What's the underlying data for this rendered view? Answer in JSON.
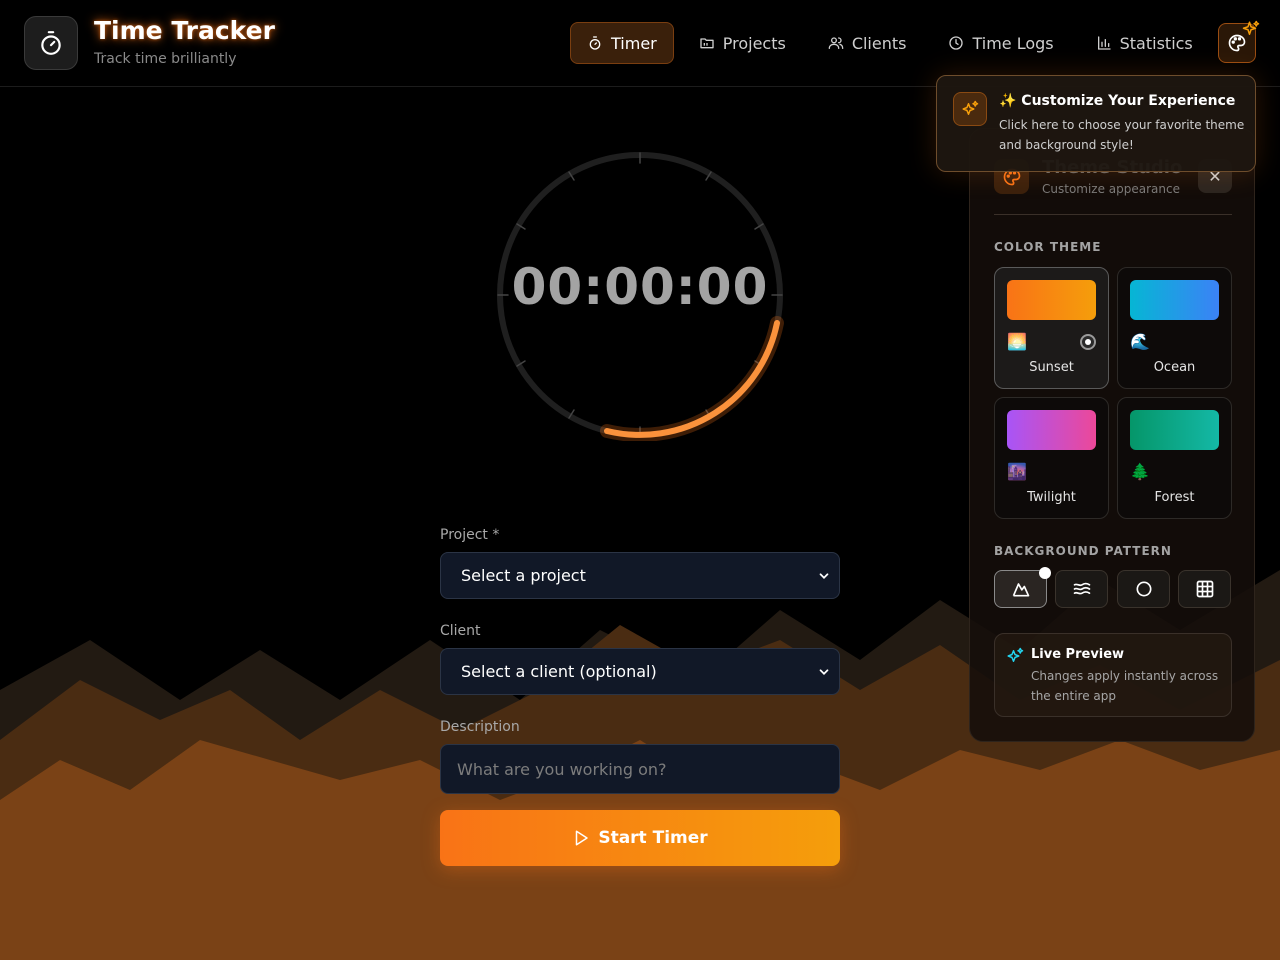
{
  "header": {
    "title": "Time Tracker",
    "subtitle": "Track time brilliantly",
    "logo_icon": "stopwatch-icon"
  },
  "nav": [
    {
      "label": "Timer",
      "icon": "timer-icon",
      "active": true
    },
    {
      "label": "Projects",
      "icon": "folder-icon",
      "active": false
    },
    {
      "label": "Clients",
      "icon": "users-icon",
      "active": false
    },
    {
      "label": "Time Logs",
      "icon": "clock-icon",
      "active": false
    },
    {
      "label": "Statistics",
      "icon": "bar-chart-icon",
      "active": false
    }
  ],
  "timer": {
    "display": "00:00:00",
    "accent_color": "#f97316"
  },
  "form": {
    "project_label": "Project *",
    "project_value": "Select a project",
    "client_label": "Client",
    "client_value": "Select a client (optional)",
    "description_label": "Description",
    "description_placeholder": "What are you working on?",
    "start_button": "Start Timer"
  },
  "tooltip": {
    "title": "✨ Customize Your Experience",
    "text": "Click here to choose your favorite theme and background style!"
  },
  "studio": {
    "title": "Theme Studio",
    "subtitle": "Customize appearance",
    "color_theme_title": "COLOR THEME",
    "themes": [
      {
        "name": "Sunset",
        "emoji": "🌅",
        "selected": true,
        "gradient_from": "#f97316",
        "gradient_to": "#f59e0b"
      },
      {
        "name": "Ocean",
        "emoji": "🌊",
        "selected": false,
        "gradient_from": "#06b6d4",
        "gradient_to": "#3b82f6"
      },
      {
        "name": "Twilight",
        "emoji": "🌆",
        "selected": false,
        "gradient_from": "#a855f7",
        "gradient_to": "#ec4899"
      },
      {
        "name": "Forest",
        "emoji": "🌲",
        "selected": false,
        "gradient_from": "#059669",
        "gradient_to": "#14b8a6"
      }
    ],
    "background_pattern_title": "BACKGROUND PATTERN",
    "patterns": [
      {
        "icon": "mountain-icon",
        "selected": true
      },
      {
        "icon": "waves-icon",
        "selected": false
      },
      {
        "icon": "circle-icon",
        "selected": false
      },
      {
        "icon": "grid-icon",
        "selected": false
      }
    ],
    "live_preview_title": "Live Preview",
    "live_preview_text": "Changes apply instantly across the entire app"
  }
}
